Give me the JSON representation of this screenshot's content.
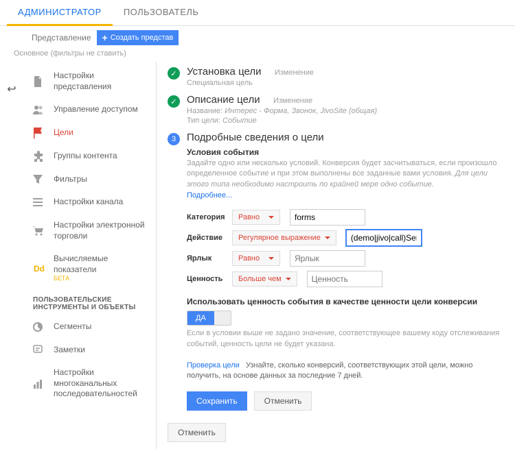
{
  "tabs": {
    "admin": "АДМИНИСТРАТОР",
    "user": "ПОЛЬЗОВАТЕЛЬ"
  },
  "subheader": {
    "label": "Представление",
    "create": "Создать представ"
  },
  "filters_note": "Основное (фильтры не ставить)",
  "sidebar": {
    "items": [
      {
        "label": "Настройки представления"
      },
      {
        "label": "Управление доступом"
      },
      {
        "label": "Цели"
      },
      {
        "label": "Группы контента"
      },
      {
        "label": "Фильтры"
      },
      {
        "label": "Настройки канала"
      },
      {
        "label": "Настройки электронной торговли"
      },
      {
        "label": "Вычисляемые показатели",
        "beta": "БЕТА"
      }
    ],
    "section": "ПОЛЬЗОВАТЕЛЬСКИЕ ИНСТРУМЕНТЫ И ОБЪЕКТЫ",
    "items2": [
      {
        "label": "Сегменты"
      },
      {
        "label": "Заметки"
      },
      {
        "label": "Настройки многоканальных последовательностей"
      }
    ]
  },
  "steps": {
    "s1": {
      "title": "Установка цели",
      "change": "Изменение",
      "sub": "Специальная цель"
    },
    "s2": {
      "title": "Описание цели",
      "change": "Изменение",
      "name_lbl": "Название: ",
      "name_val": "Интерес - Форма, Звонок, JivoSite (общая)",
      "type_lbl": "Тип цели: ",
      "type_val": "Событие"
    },
    "s3": {
      "num": "3",
      "title": "Подробные сведения о цели"
    }
  },
  "cond": {
    "title": "Условия события",
    "desc1": "Задайте одно или несколько условий. Конверсия будет засчитываться, если произошло определенное событие и при этом выполнены все заданные вами условия. ",
    "desc2": "Для цели этого типа необходимо настроить по крайней мере одно событие.",
    "link": "Подробнее..."
  },
  "table": {
    "rows": [
      {
        "lbl": "Категория",
        "dd": "Равно",
        "val": "forms",
        "placeholder": "Категория"
      },
      {
        "lbl": "Действие",
        "dd": "Регулярное выражение",
        "val": "(demo|jivo|call)Sent",
        "placeholder": "Действие"
      },
      {
        "lbl": "Ярлык",
        "dd": "Равно",
        "val": "",
        "placeholder": "Ярлык"
      },
      {
        "lbl": "Ценность",
        "dd": "Больше чем",
        "val": "",
        "placeholder": "Ценность"
      }
    ]
  },
  "toggle": {
    "label": "Использовать ценность события в качестве ценности цели конверсии",
    "on": "ДА",
    "desc": "Если в условии выше не задано значение, соответствующее вашему коду отслеживания событий, ценность цели не будет указана."
  },
  "verify": {
    "link": "Проверка цели",
    "desc": "Узнайте, сколько конверсий, соответствующих этой цели, можно получить, на основе данных за последние 7 дней."
  },
  "actions": {
    "save": "Сохранить",
    "cancel": "Отменить",
    "cancel2": "Отменить"
  }
}
